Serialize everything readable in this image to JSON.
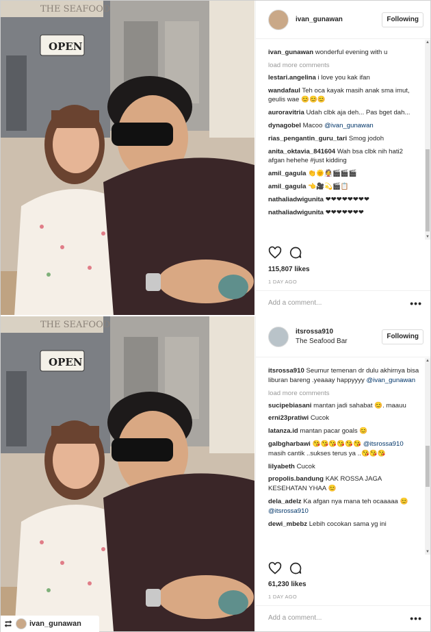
{
  "posts": [
    {
      "username": "ivan_gunawan",
      "location": "",
      "follow_label": "Following",
      "avatar": "avatar",
      "photo_sign": "OPEN",
      "photo_shop_sign": "THE SEAFOOD",
      "comments": [
        {
          "user": "ivan_gunawan",
          "text": "wonderful evening with u"
        },
        {
          "type": "loadmore",
          "text": "load more comments"
        },
        {
          "user": "lestari.angelina",
          "text": "i love you kak ifan"
        },
        {
          "user": "wandafaul",
          "text": "Teh oca kayak masih anak sma imut, geulis wae 😊😊😊"
        },
        {
          "user": "auroravitria",
          "text": "Udah clbk aja deh... Pas bget dah..."
        },
        {
          "user": "dynagobel",
          "text": "Macoo ",
          "mention": "@ivan_gunawan"
        },
        {
          "user": "rias_pengantin_guru_tari",
          "text": "Smog jodoh"
        },
        {
          "user": "anita_oktavia_841604",
          "text": "Wah bsa clbk nih hati2 afgan hehehe #just kidding"
        },
        {
          "user": "amil_gagula",
          "text": "👏🌞👰🎬🎬🎬"
        },
        {
          "user": "amil_gagula",
          "text": "👈🎥💫🎬📋"
        },
        {
          "user": "nathaliadwigunita",
          "text": "❤❤❤❤❤❤❤❤"
        },
        {
          "user": "nathaliadwigunita",
          "text": "❤❤❤❤❤❤❤"
        }
      ],
      "likes": "115,807 likes",
      "ago": "1 DAY AGO",
      "add_comment_placeholder": "Add a comment...",
      "more_label": "•••"
    },
    {
      "username": "itsrossa910",
      "location": "The Seafood Bar",
      "follow_label": "Following",
      "avatar": "avatar",
      "photo_sign": "OPEN",
      "photo_shop_sign": "THE SEAFOOD",
      "comments": [
        {
          "user": "itsrossa910",
          "text": "Seumur temenan dr dulu akhirnya bisa liburan bareng .yeaaay happyyyy ",
          "mention": "@ivan_gunawan"
        },
        {
          "type": "loadmore",
          "text": "load more comments"
        },
        {
          "user": "sucipebiasani",
          "text": "mantan jadi sahabat 😊. maauu"
        },
        {
          "user": "erni23pratiwi",
          "text": "Cucok"
        },
        {
          "user": "latanza.id",
          "text": "mantan pacar goals 😊"
        },
        {
          "user": "galbgharbawi",
          "text": "😘😘😘😘😘😘",
          "mention2": "@itsrossa910",
          "text2": " masih cantik ..sukses terus ya ..😘😘😘"
        },
        {
          "user": "lilyabeth",
          "text": "Cucok"
        },
        {
          "user": "propolis.bandung",
          "text": "KAK ROSSA JAGA KESEHATAN YHAA 😊"
        },
        {
          "user": "dela_adelz",
          "text": "Ka afgan nya mana teh ocaaaaa 😊 ",
          "mention": "@itsrossa910"
        },
        {
          "user": "dewi_mbebz",
          "text": "Lebih cocokan sama yg ini"
        }
      ],
      "likes": "61,230 likes",
      "ago": "1 DAY AGO",
      "add_comment_placeholder": "Add a comment...",
      "more_label": "•••"
    }
  ],
  "repost_bar": {
    "username": "ivan_gunawan"
  },
  "icons": {
    "heart": "heart-icon",
    "comment": "comment-bubble-icon",
    "repost": "repost-icon"
  }
}
